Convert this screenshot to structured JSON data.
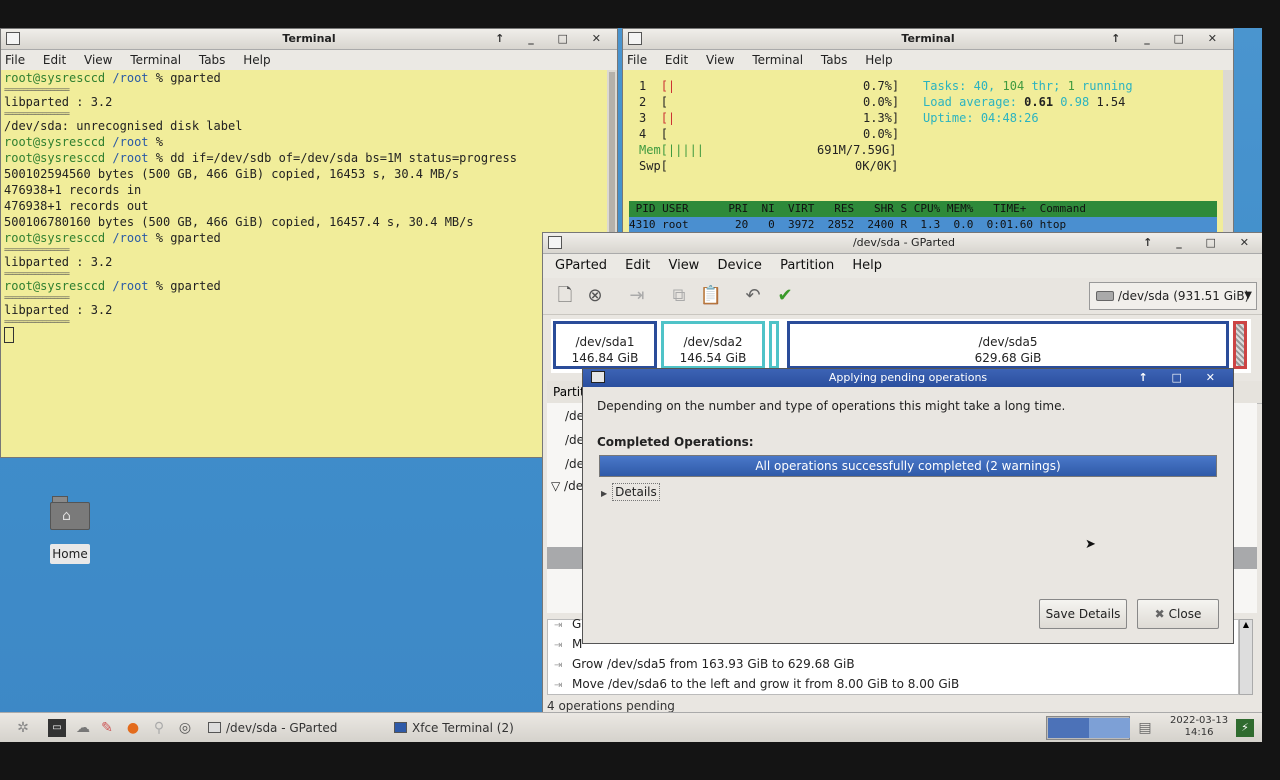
{
  "terminal1": {
    "title": "Terminal",
    "menu": [
      "File",
      "Edit",
      "View",
      "Terminal",
      "Tabs",
      "Help"
    ],
    "lines": [
      {
        "user": "root@sysresccd",
        "dir": "/root",
        "cmd": "% gparted"
      },
      {
        "sep": "================="
      },
      {
        "text": "libparted : 3.2"
      },
      {
        "sep": "================="
      },
      {
        "text": "/dev/sda: unrecognised disk label"
      },
      {
        "user": "root@sysresccd",
        "dir": "/root",
        "cmd": "%"
      },
      {
        "user": "root@sysresccd",
        "dir": "/root",
        "cmd": "% dd if=/dev/sdb of=/dev/sda bs=1M status=progress"
      },
      {
        "text": "500102594560 bytes (500 GB, 466 GiB) copied, 16453 s, 30.4 MB/s"
      },
      {
        "text": "476938+1 records in"
      },
      {
        "text": "476938+1 records out"
      },
      {
        "text": "500106780160 bytes (500 GB, 466 GiB) copied, 16457.4 s, 30.4 MB/s"
      },
      {
        "user": "root@sysresccd",
        "dir": "/root",
        "cmd": "% gparted"
      },
      {
        "sep": "================="
      },
      {
        "text": "libparted : 3.2"
      },
      {
        "sep": "================="
      },
      {
        "user": "root@sysresccd",
        "dir": "/root",
        "cmd": "% gparted"
      },
      {
        "sep": "================="
      },
      {
        "text": "libparted : 3.2"
      },
      {
        "sep": "================="
      }
    ]
  },
  "terminal2": {
    "title": "Terminal",
    "menu": [
      "File",
      "Edit",
      "View",
      "Terminal",
      "Tabs",
      "Help"
    ],
    "cpu": [
      {
        "n": "1",
        "bar": "[|",
        "val": "0.7%]"
      },
      {
        "n": "2",
        "bar": "[",
        "val": "0.0%]"
      },
      {
        "n": "3",
        "bar": "[|",
        "val": "1.3%]"
      },
      {
        "n": "4",
        "bar": "[",
        "val": "0.0%]"
      }
    ],
    "mem": {
      "label": "Mem[|||||",
      "val": "691M/7.59G]"
    },
    "swp": {
      "label": "Swp[",
      "val": "0K/0K]"
    },
    "tasks_label": "Tasks:",
    "tasks_val": "40,",
    "thr_val": "104",
    "thr_label": "thr;",
    "running_val": "1",
    "running_label": "running",
    "load_label": "Load average:",
    "load1": "0.61",
    "load5": "0.98",
    "load15": "1.54",
    "uptime_label": "Uptime:",
    "uptime_val": "04:48:26",
    "header": " PID USER      PRI  NI  VIRT   RES   SHR S CPU% MEM%   TIME+  Command",
    "proc": "4310 root       20   0  3972  2852  2400 R  1.3  0.0  0:01.60 htop"
  },
  "gparted": {
    "title": "/dev/sda - GParted",
    "menu": [
      "GParted",
      "Edit",
      "View",
      "Device",
      "Partition",
      "Help"
    ],
    "device": "/dev/sda",
    "device_size": "(931.51 GiB)",
    "partitions": [
      {
        "name": "/dev/sda1",
        "size": "146.84 GiB"
      },
      {
        "name": "/dev/sda2",
        "size": "146.54 GiB"
      },
      {
        "name": "/dev/sda5",
        "size": "629.68 GiB"
      }
    ],
    "list_header": "Partit",
    "list_rows": [
      "/de",
      "/de",
      "/de",
      "/de"
    ],
    "operations": [
      "G",
      "M",
      "Grow /dev/sda5 from 163.93 GiB to 629.68 GiB",
      "Move /dev/sda6 to the left and grow it from 8.00 GiB to 8.00 GiB"
    ],
    "status": "4 operations pending"
  },
  "dialog": {
    "title": "Applying pending operations",
    "message": "Depending on the number and type of operations this might take a long time.",
    "completed_label": "Completed Operations:",
    "progress_text": "All operations successfully completed (2 warnings)",
    "progress_fraction": 1.0,
    "details_label": "Details",
    "save_label": "Save Details",
    "close_label": "Close"
  },
  "desktop": {
    "home_label": "Home"
  },
  "taskbar": {
    "tasks": [
      "/dev/sda - GParted",
      "Xfce Terminal (2)"
    ],
    "date": "2022-03-13",
    "time": "14:16"
  },
  "colors": {
    "terminal_bg": "#f1ed9a",
    "desktop_bg": "#3f8dca",
    "selection": "#2f5aa8",
    "htop_header": "#2e8a3a"
  }
}
